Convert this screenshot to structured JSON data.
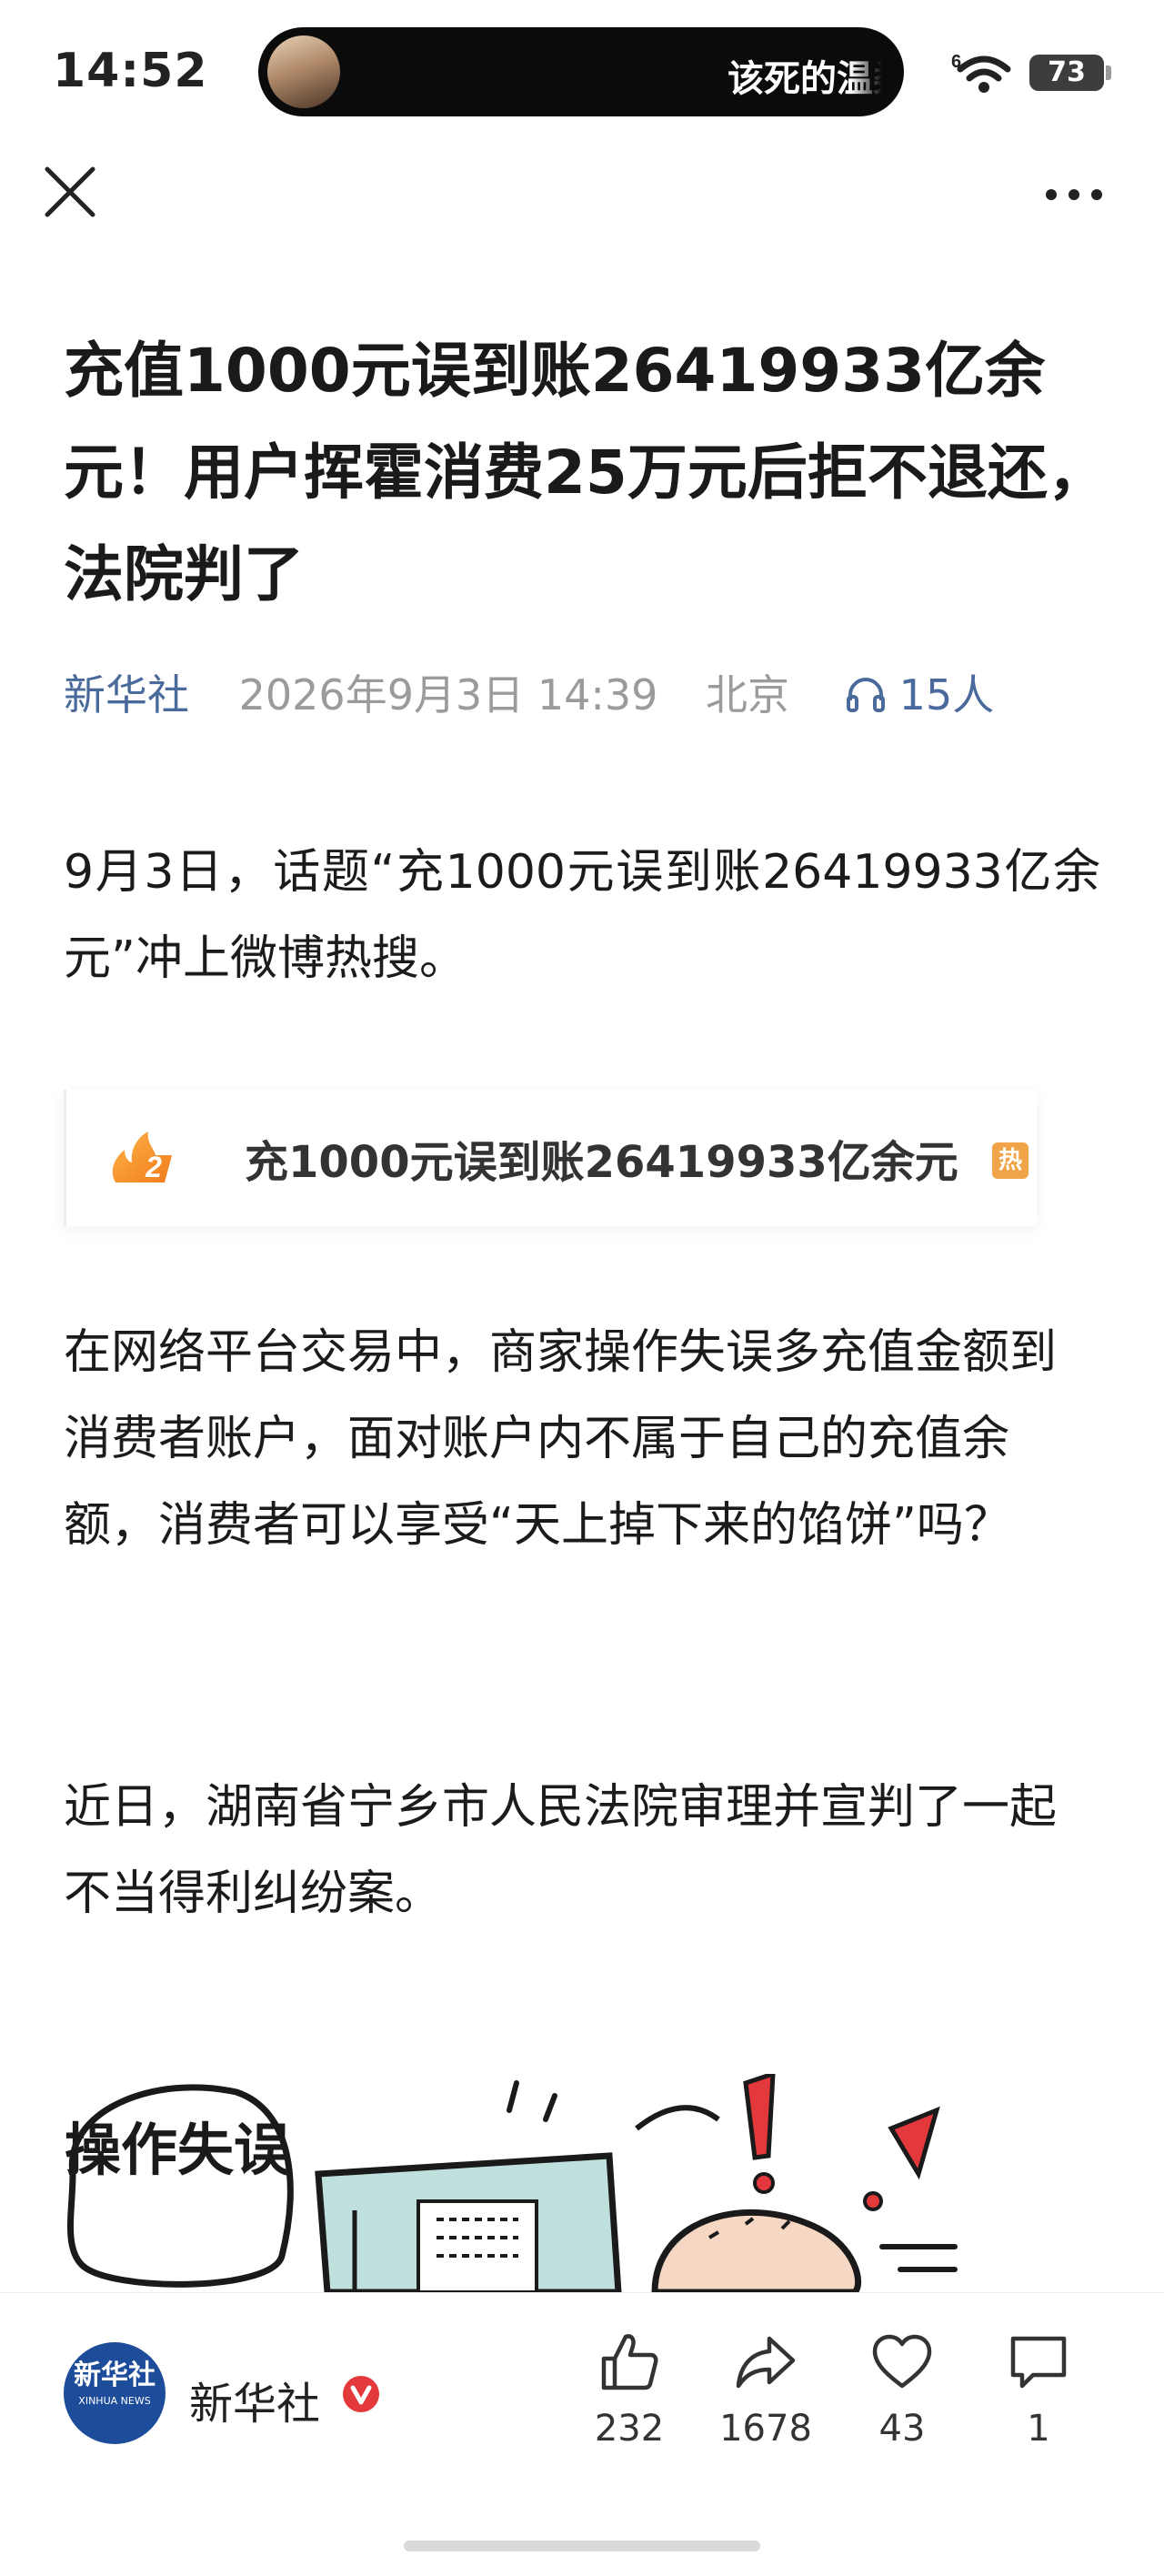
{
  "status_bar": {
    "time": "14:52",
    "island_text": "该死的温柔",
    "network_label": "6",
    "battery": "73",
    "icons": [
      "wifi-icon",
      "battery-icon"
    ]
  },
  "nav": {
    "close_icon": "close-icon",
    "more_icon": "more-icon"
  },
  "article": {
    "title": "充值1000元误到账26419933亿余元！用户挥霍消费25万元后拒不退还，法院判了",
    "source": "新华社",
    "datetime": "2026年9月3日 14:39",
    "location": "北京",
    "listeners": "15人",
    "paragraphs": [
      "9月3日，话题“充1000元误到账26419933亿余元”冲上微博热搜。",
      "在网络平台交易中，商家操作失误多充值金额到消费者账户，面对账户内不属于自己的充值余额，消费者可以享受“天上掉下来的馅饼”吗？",
      "近日，湖南省宁乡市人民法院审理并宣判了一起不当得利纠纷案。"
    ],
    "hot_search": {
      "rank": "2",
      "title": "充1000元误到账26419933亿余元",
      "badge": "热"
    },
    "illustration_text": "操作失误"
  },
  "bottom_bar": {
    "author_name": "新华社",
    "author_avatar_text": "新华社",
    "author_avatar_sub": "XINHUA NEWS",
    "likes": "232",
    "shares": "1678",
    "favorites": "43",
    "comments": "1"
  },
  "colors": {
    "source_blue": "#4a6a9c",
    "meta_gray": "#9b9b9b",
    "hot_orange": "#f0a347",
    "verified_red": "#e4393c"
  }
}
